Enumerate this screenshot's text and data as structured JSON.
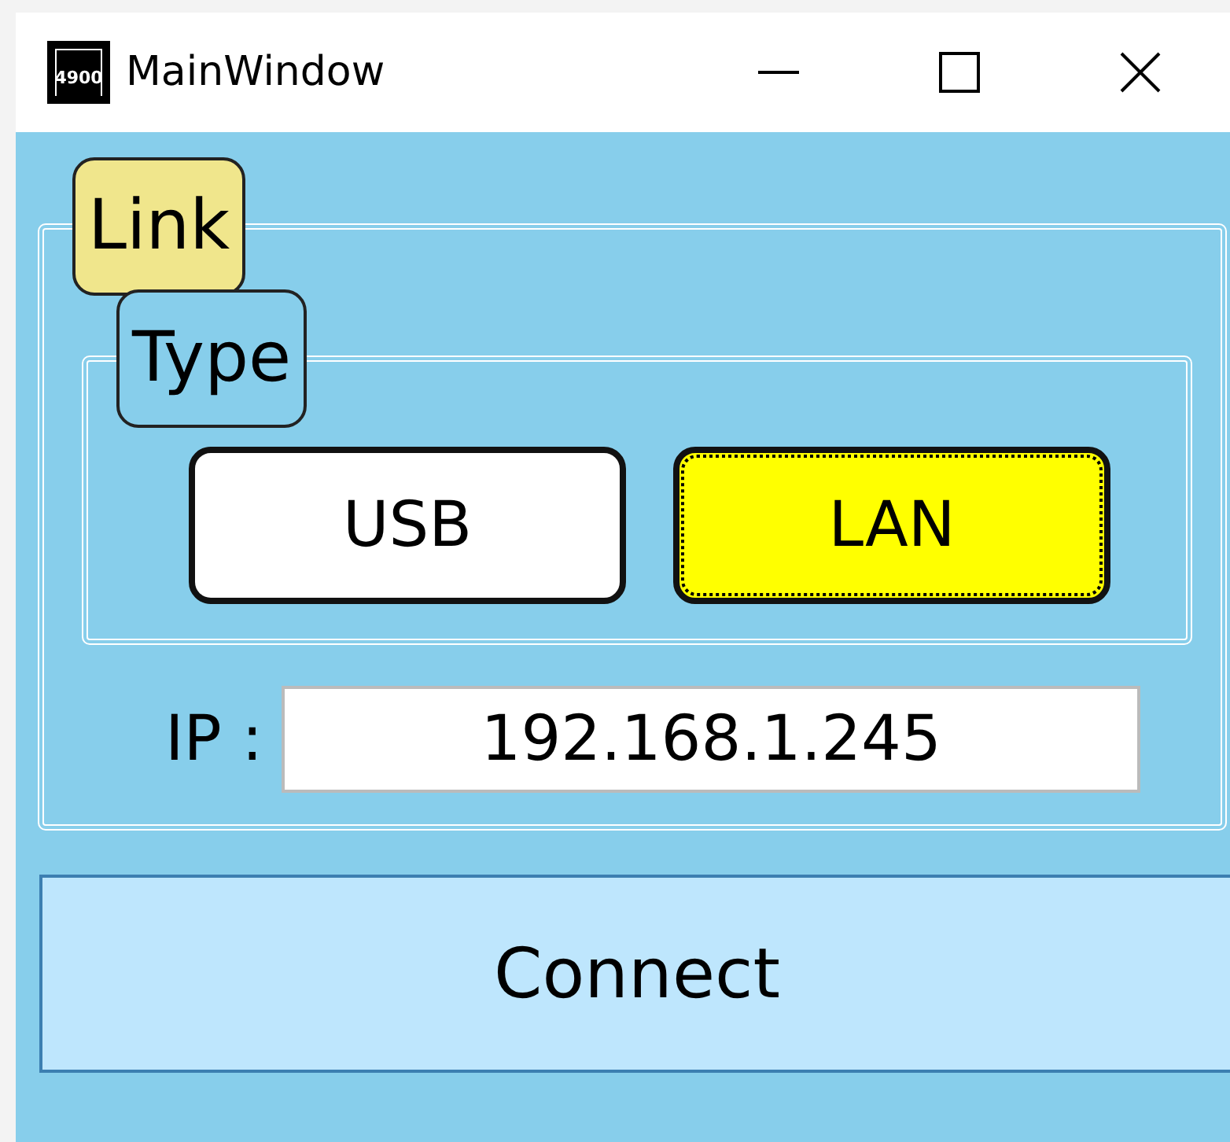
{
  "window": {
    "title": "MainWindow",
    "icon_text": "4900"
  },
  "link_group": {
    "legend": "Link",
    "type_group": {
      "legend": "Type",
      "options": [
        {
          "label": "USB",
          "selected": false
        },
        {
          "label": "LAN",
          "selected": true
        }
      ]
    },
    "ip": {
      "label": "IP :",
      "value": "192.168.1.245"
    }
  },
  "connect_button": {
    "label": "Connect"
  }
}
